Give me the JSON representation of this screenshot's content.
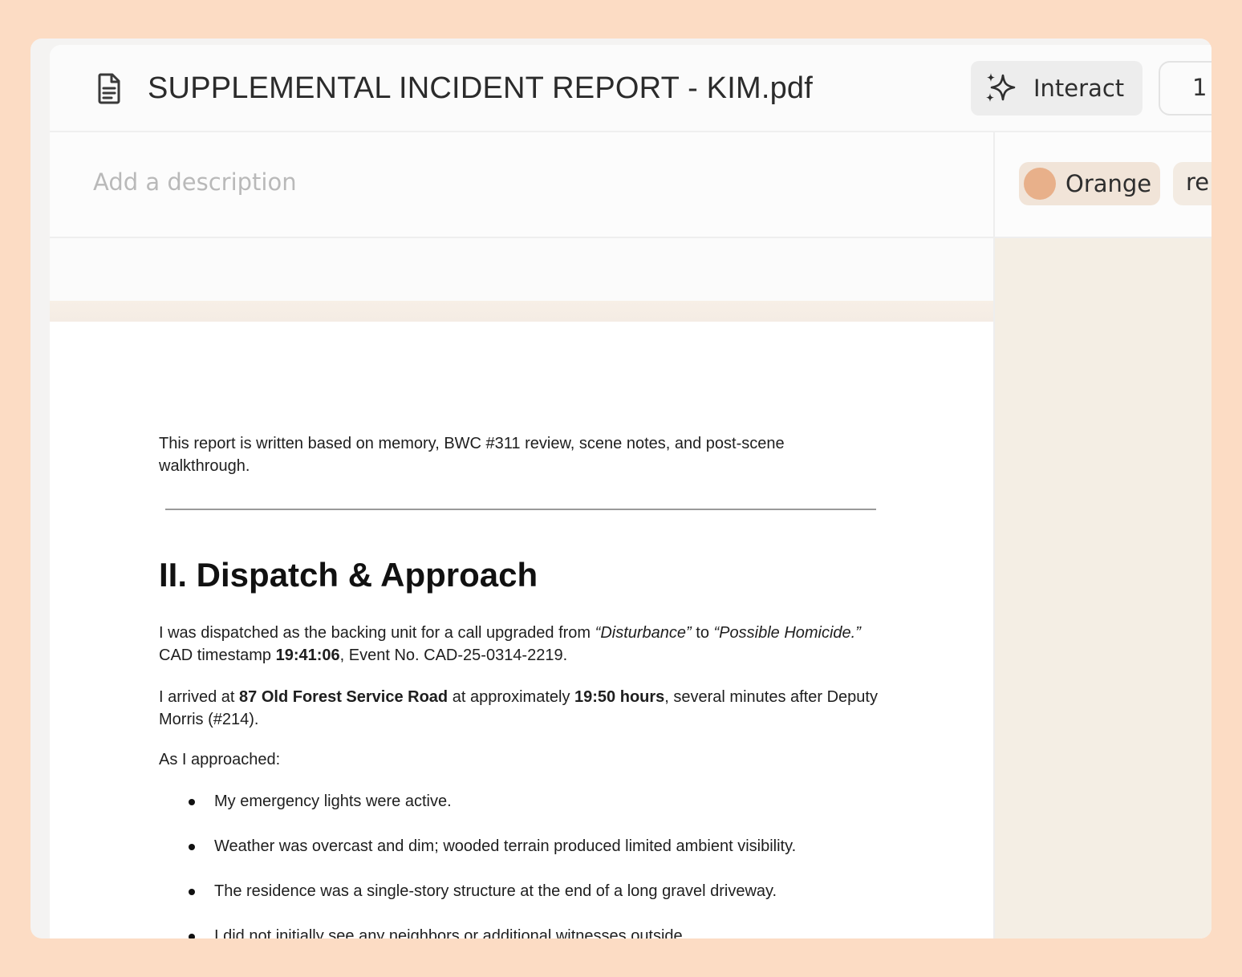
{
  "header": {
    "title": "SUPPLEMENTAL INCIDENT REPORT - KIM.pdf",
    "interact_label": "Interact",
    "page_number": "1"
  },
  "description": {
    "placeholder": "Add a description"
  },
  "tags": [
    {
      "label": "Orange",
      "color": "#e8b08a"
    },
    {
      "label": "re"
    }
  ],
  "document": {
    "intro": "This report is written based on memory, BWC #311 review, scene notes, and post-scene walkthrough.",
    "section_title": "II. Dispatch & Approach",
    "p1": {
      "a": "I was dispatched as the backing unit for a call upgraded from ",
      "b": "“Disturbance”",
      "c": " to ",
      "d": "“Possible Homicide.”",
      "e": " CAD timestamp ",
      "f": "19:41:06",
      "g": ", Event No. CAD-25-0314-2219."
    },
    "p2": {
      "a": "I arrived at ",
      "b": "87 Old Forest Service Road",
      "c": " at approximately ",
      "d": "19:50 hours",
      "e": ", several minutes after Deputy Morris (#214)."
    },
    "p3": "As I approached:",
    "bullets": [
      "My emergency lights were active.",
      "Weather was overcast and dim; wooded terrain produced limited ambient visibility.",
      "The residence was a single-story structure at the end of a long gravel driveway.",
      "I did not initially see any neighbors or additional witnesses outside."
    ]
  }
}
